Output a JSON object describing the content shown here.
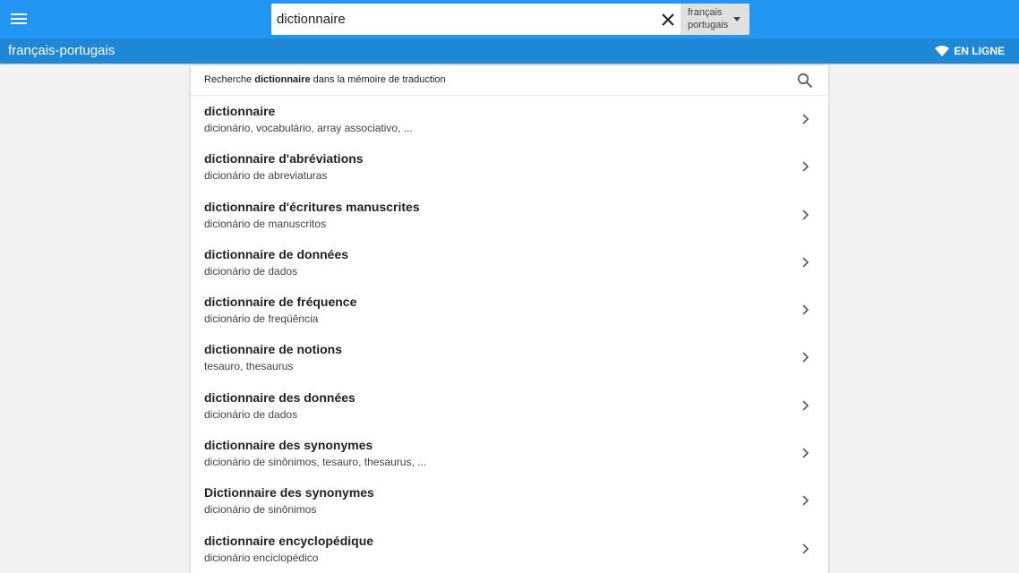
{
  "header": {
    "menu_icon": "hamburger-menu-icon",
    "search": {
      "value": "dictionnaire",
      "clear_icon": "close-icon"
    },
    "language_selector": {
      "source": "français",
      "target": "portugais",
      "icon": "caret-down-icon"
    }
  },
  "subheader": {
    "pair_title": "français-portugais",
    "status_icon": "wifi-icon",
    "status_label": "EN LIGNE"
  },
  "translation_memory": {
    "prefix": "Recherche ",
    "term": "dictionnaire",
    "suffix": " dans la mémoire de traduction",
    "icon": "search-icon"
  },
  "results": [
    {
      "term": "dictionnaire",
      "translations": "dicionário, vocabulário, array associativo, ..."
    },
    {
      "term": "dictionnaire d'abréviations",
      "translations": "dicionário de abreviaturas"
    },
    {
      "term": "dictionnaire d'écritures manuscrites",
      "translations": "dicionário de manuscritos"
    },
    {
      "term": "dictionnaire de données",
      "translations": "dicionário de dados"
    },
    {
      "term": "dictionnaire de fréquence",
      "translations": "dicionário de freqüência"
    },
    {
      "term": "dictionnaire de notions",
      "translations": "tesauro, thesaurus"
    },
    {
      "term": "dictionnaire des données",
      "translations": "dicionário de dados"
    },
    {
      "term": "dictionnaire des synonymes",
      "translations": "dicionário de sinônimos, tesauro, thesaurus, ..."
    },
    {
      "term": "Dictionnaire des synonymes",
      "translations": "dicionário de sinônimos"
    },
    {
      "term": "dictionnaire encyclopédique",
      "translations": "dicionário enciclopédico"
    }
  ],
  "colors": {
    "topbar": "#2196f3",
    "subbar": "#1e88d6",
    "background": "#f2f2f2"
  }
}
